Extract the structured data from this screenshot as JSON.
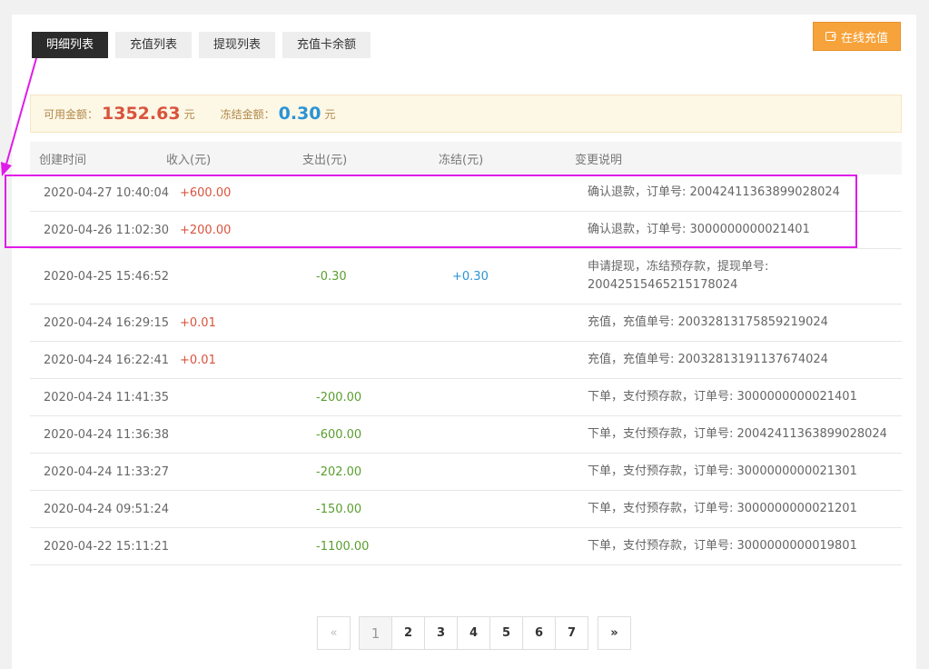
{
  "tabs": [
    {
      "label": "明细列表",
      "active": true
    },
    {
      "label": "充值列表",
      "active": false
    },
    {
      "label": "提现列表",
      "active": false
    },
    {
      "label": "充值卡余额",
      "active": false
    }
  ],
  "recharge_button": {
    "label": "在线充值",
    "icon": "wallet-icon"
  },
  "balance": {
    "available_label": "可用金额：",
    "available_value": "1352.63",
    "available_unit": "元",
    "frozen_label": "冻结金额：",
    "frozen_value": "0.30",
    "frozen_unit": "元"
  },
  "table": {
    "headers": [
      "创建时间",
      "收入(元)",
      "支出(元)",
      "冻结(元)",
      "变更说明"
    ],
    "rows": [
      {
        "time": "2020-04-27 10:40:04",
        "income": "+600.00",
        "expense": "",
        "frozen": "",
        "desc": "确认退款，订单号: 20042411363899028024"
      },
      {
        "time": "2020-04-26 11:02:30",
        "income": "+200.00",
        "expense": "",
        "frozen": "",
        "desc": "确认退款，订单号: 3000000000021401"
      },
      {
        "time": "2020-04-25 15:46:52",
        "income": "",
        "expense": "-0.30",
        "frozen": "+0.30",
        "desc": "申请提现，冻结预存款，提现单号:",
        "desc2": "20042515465215178024"
      },
      {
        "time": "2020-04-24 16:29:15",
        "income": "+0.01",
        "expense": "",
        "frozen": "",
        "desc": "充值，充值单号: 20032813175859219024"
      },
      {
        "time": "2020-04-24 16:22:41",
        "income": "+0.01",
        "expense": "",
        "frozen": "",
        "desc": "充值，充值单号: 20032813191137674024"
      },
      {
        "time": "2020-04-24 11:41:35",
        "income": "",
        "expense": "-200.00",
        "frozen": "",
        "desc": "下单，支付预存款，订单号: 3000000000021401"
      },
      {
        "time": "2020-04-24 11:36:38",
        "income": "",
        "expense": "-600.00",
        "frozen": "",
        "desc": "下单，支付预存款，订单号: 20042411363899028024"
      },
      {
        "time": "2020-04-24 11:33:27",
        "income": "",
        "expense": "-202.00",
        "frozen": "",
        "desc": "下单，支付预存款，订单号: 3000000000021301"
      },
      {
        "time": "2020-04-24 09:51:24",
        "income": "",
        "expense": "-150.00",
        "frozen": "",
        "desc": "下单，支付预存款，订单号: 3000000000021201"
      },
      {
        "time": "2020-04-22 15:11:21",
        "income": "",
        "expense": "-1100.00",
        "frozen": "",
        "desc": "下单，支付预存款，订单号: 3000000000019801"
      }
    ]
  },
  "pagination": {
    "prev": "«",
    "pages": [
      "1",
      "2",
      "3",
      "4",
      "5",
      "6",
      "7"
    ],
    "current": "1",
    "next": "»"
  },
  "colors": {
    "income": "#d9533d",
    "expense": "#5a9e2f",
    "frozen": "#2a93d5",
    "accent": "#f7a33b",
    "annotation": "#e01be8"
  }
}
